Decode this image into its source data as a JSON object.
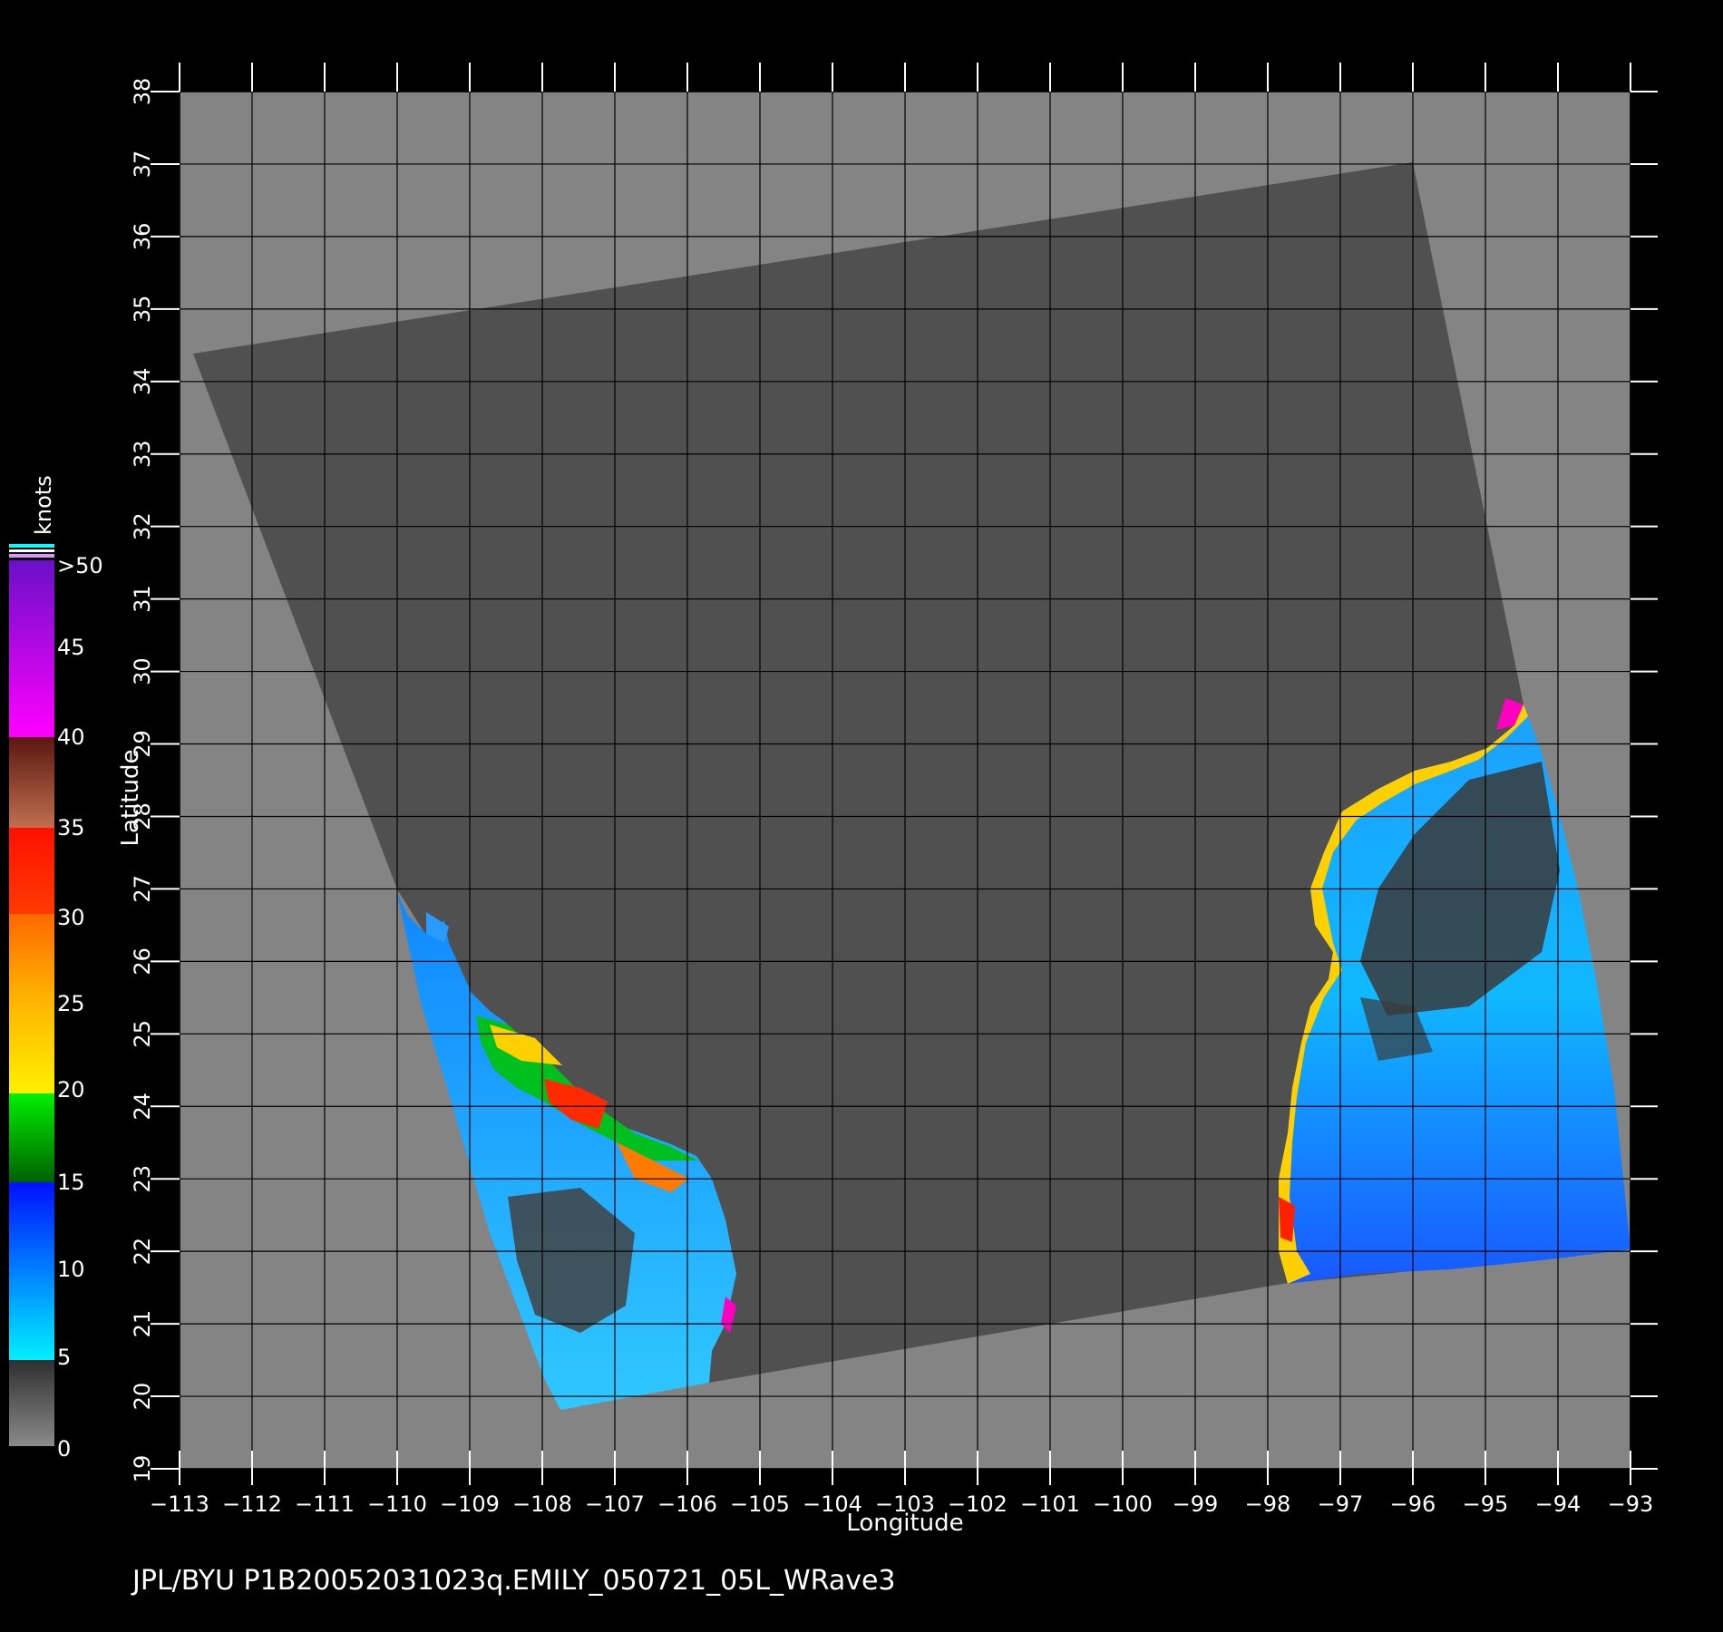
{
  "map": {
    "xaxis": {
      "label": "Longitude",
      "min": -113,
      "max": -93,
      "ticks": [
        -113,
        -112,
        -111,
        -110,
        -109,
        -108,
        -107,
        -106,
        -105,
        -104,
        -103,
        -102,
        -101,
        -100,
        -99,
        -98,
        -97,
        -96,
        -95,
        -94,
        -93
      ],
      "tick_labels": [
        "−113",
        "−112",
        "−111",
        "−110",
        "−109",
        "−108",
        "−107",
        "−106",
        "−105",
        "−104",
        "−103",
        "−102",
        "−101",
        "−100",
        "−99",
        "−98",
        "−97",
        "−96",
        "−95",
        "−94",
        "−93"
      ]
    },
    "yaxis": {
      "label": "Latitude",
      "min": 19,
      "max": 38,
      "ticks": [
        19,
        20,
        21,
        22,
        23,
        24,
        25,
        26,
        27,
        28,
        29,
        30,
        31,
        32,
        33,
        34,
        35,
        36,
        37,
        38
      ],
      "tick_labels": [
        "19",
        "20",
        "21",
        "22",
        "23",
        "24",
        "25",
        "26",
        "27",
        "28",
        "29",
        "30",
        "31",
        "32",
        "33",
        "34",
        "35",
        "36",
        "37",
        "38"
      ]
    },
    "grid": true,
    "colors": {
      "background": "#000000",
      "land": "#848484",
      "swath": "#505050",
      "grid": "#000000"
    }
  },
  "colorbar": {
    "unit": "knots",
    "labels": [
      ">50",
      "45",
      "40",
      "35",
      "30",
      "25",
      "20",
      "15",
      "10",
      "5",
      "0"
    ],
    "segments": [
      {
        "from": 0,
        "to": 5,
        "top": "#2f2f2f",
        "bottom": "#8a8a8a"
      },
      {
        "from": 5,
        "to": 15,
        "top": "#0010ff",
        "bottom": "#00f0ff"
      },
      {
        "from": 15,
        "to": 20,
        "top": "#00f000",
        "bottom": "#006000"
      },
      {
        "from": 20,
        "to": 30,
        "top": "#ffd000",
        "bottom": "#ff7000"
      },
      {
        "from": 30,
        "to": 35,
        "top": "#ff1000",
        "bottom": "#ff3000"
      },
      {
        "from": 35,
        "to": 40,
        "top": "#6a1a10",
        "bottom": "#c07050"
      },
      {
        "from": 40,
        "to": 50,
        "top": "#7010c0",
        "bottom": "#ff00ff"
      }
    ]
  },
  "footer": "JPL/BYU  P1B20052031023q.EMILY_050721_05L_WRave3"
}
